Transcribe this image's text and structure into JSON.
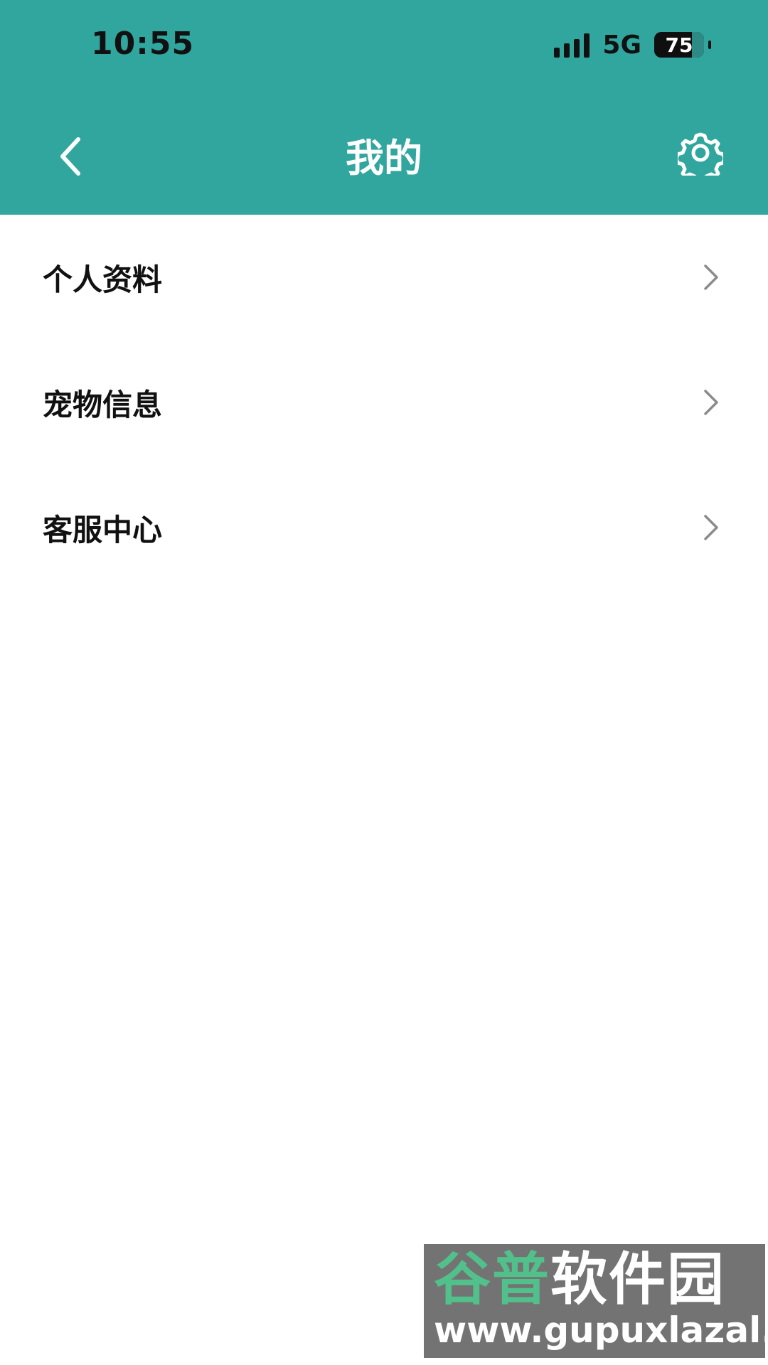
{
  "status_bar": {
    "time": "10:55",
    "network": "5G",
    "battery_level": "75",
    "battery_percent": 75
  },
  "header": {
    "title": "我的",
    "bg_color": "#31a69f"
  },
  "menu": {
    "items": [
      {
        "label": "个人资料"
      },
      {
        "label": "宠物信息"
      },
      {
        "label": "客服中心"
      }
    ]
  },
  "watermark": {
    "brand_1": "谷普",
    "brand_2": "软件园",
    "url": "www.gupuxlazal.com"
  }
}
